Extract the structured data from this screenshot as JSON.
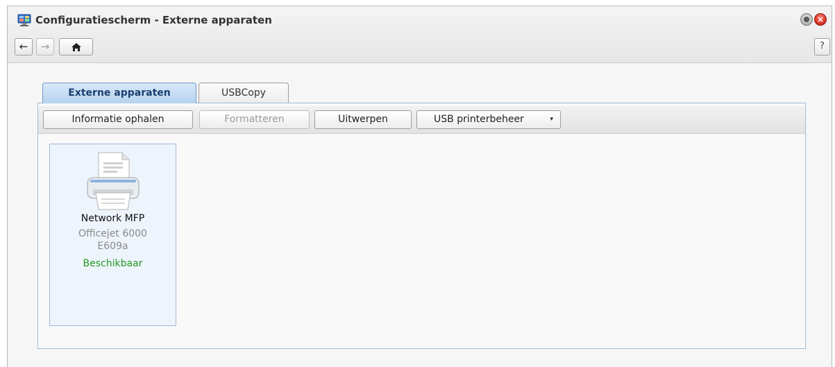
{
  "window": {
    "title": "Configuratiescherm - Externe apparaten",
    "app_icon": "control-panel-icon"
  },
  "nav": {
    "back_icon": "←",
    "forward_icon": "→",
    "home_icon": "⌂",
    "help_label": "?"
  },
  "tabs": [
    {
      "label": "Externe apparaten",
      "active": true
    },
    {
      "label": "USBCopy",
      "active": false
    }
  ],
  "toolbar": {
    "info_label": "Informatie ophalen",
    "format_label": "Formatteren",
    "eject_label": "Uitwerpen",
    "usb_printer_label": "USB printerbeheer",
    "caret": "▾"
  },
  "device": {
    "name": "Network MFP",
    "model": "Officejet 6000 E609a",
    "status": "Beschikbaar",
    "status_color": "#229922",
    "icon": "printer-icon"
  },
  "colors": {
    "accent": "#6f9ccb",
    "close": "#e0392b"
  }
}
